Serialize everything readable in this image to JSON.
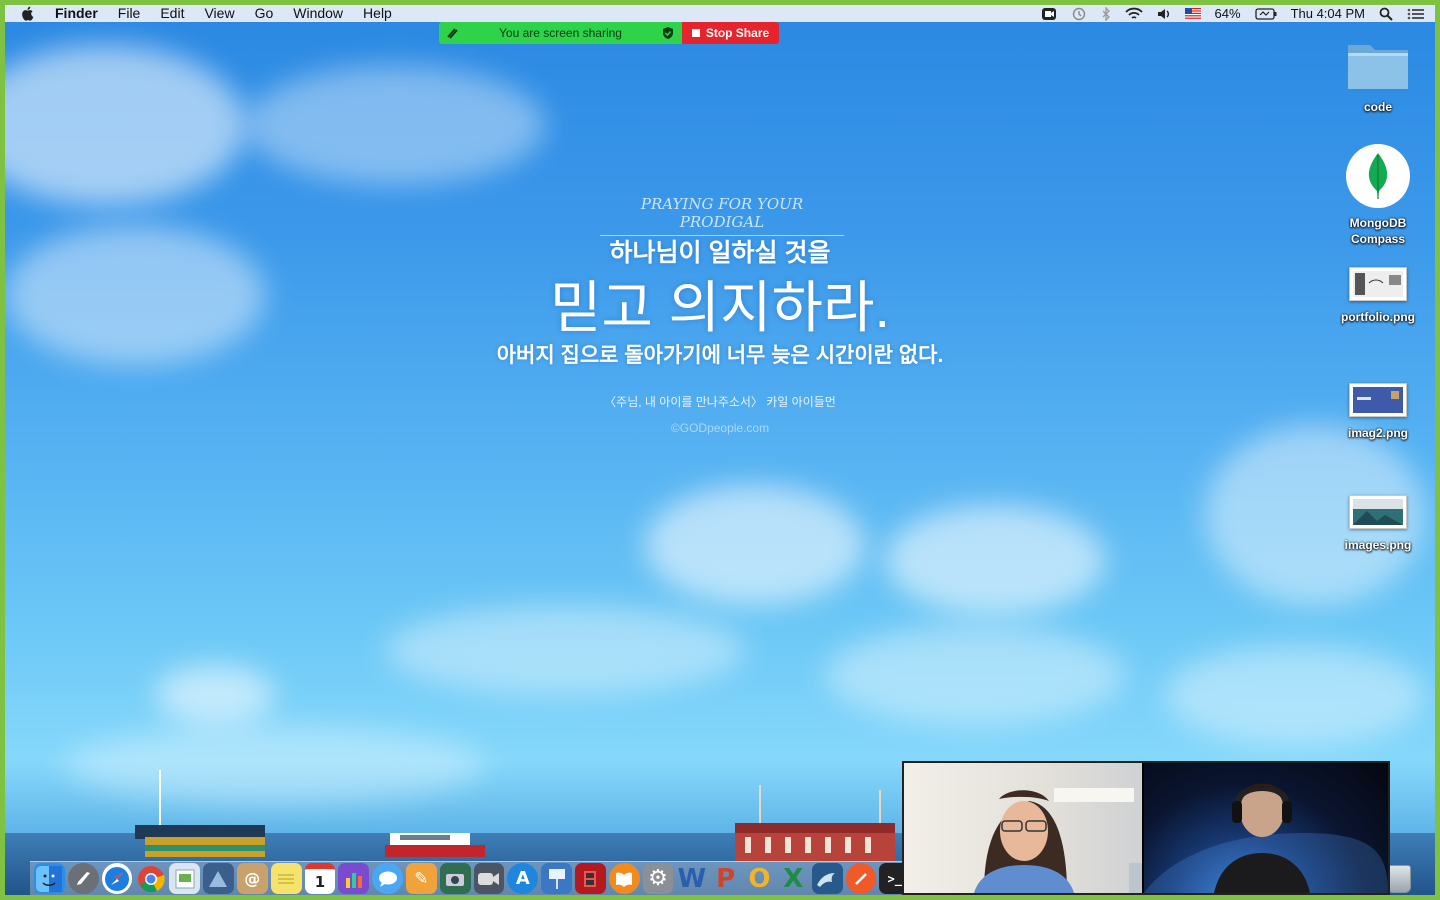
{
  "menubar": {
    "app_name": "Finder",
    "items": [
      "File",
      "Edit",
      "View",
      "Go",
      "Window",
      "Help"
    ],
    "status": {
      "battery": "64%",
      "clock": "Thu 4:04 PM"
    }
  },
  "screen_share": {
    "status_text": "You are screen sharing",
    "stop_label": "Stop Share"
  },
  "wallpaper": {
    "eyebrow": "PRAYING FOR YOUR PRODIGAL",
    "line1": "하나님이 일하실 것을",
    "line2": "믿고 의지하라.",
    "line3": "아버지 집으로 돌아가기에 너무 늦은 시간이란 없다.",
    "line4": "〈주님, 내 아이를 만나주소서〉 카일 아이들먼",
    "line5": "©GODpeople.com"
  },
  "desktop_icons": [
    {
      "label": "code",
      "icon": "folder-icon"
    },
    {
      "label": "MongoDB Compass",
      "icon": "mongodb-compass-icon"
    },
    {
      "label": "portfolio.png",
      "icon": "image-thumbnail-icon"
    },
    {
      "label": "imag2.png",
      "icon": "image-thumbnail-icon"
    },
    {
      "label": "images.png",
      "icon": "image-thumbnail-icon"
    }
  ],
  "dock": {
    "items": [
      {
        "name": "finder",
        "color": "#2b8fe8",
        "glyph": ""
      },
      {
        "name": "launchpad",
        "color": "#6b6f76",
        "glyph": "🚀"
      },
      {
        "name": "safari",
        "color": "#1e7ee0",
        "glyph": "⊕"
      },
      {
        "name": "chrome",
        "color": "#e8e8e8",
        "glyph": ""
      },
      {
        "name": "preview",
        "color": "#d9e6f2",
        "glyph": ""
      },
      {
        "name": "photo-app",
        "color": "#3a5f8c",
        "glyph": ""
      },
      {
        "name": "contacts",
        "color": "#c8a26a",
        "glyph": "@"
      },
      {
        "name": "notes",
        "color": "#f6e36b",
        "glyph": ""
      },
      {
        "name": "calendar",
        "color": "#ffffff",
        "glyph": "1"
      },
      {
        "name": "ibooks-author",
        "color": "#7a4bd1",
        "glyph": ""
      },
      {
        "name": "messages",
        "color": "#4aa7f3",
        "glyph": "💬"
      },
      {
        "name": "pages",
        "color": "#f0a33a",
        "glyph": "✎"
      },
      {
        "name": "image-capture",
        "color": "#2f6e4f",
        "glyph": ""
      },
      {
        "name": "facetime",
        "color": "#4b5563",
        "glyph": "◉"
      },
      {
        "name": "app-store",
        "color": "#1f86e0",
        "glyph": "A"
      },
      {
        "name": "keynote",
        "color": "#3a78c4",
        "glyph": ""
      },
      {
        "name": "photo-booth",
        "color": "#b3191f",
        "glyph": ""
      },
      {
        "name": "ibooks",
        "color": "#f38a1d",
        "glyph": "▣"
      },
      {
        "name": "system-preferences",
        "color": "#8b8f96",
        "glyph": "⚙"
      },
      {
        "name": "word",
        "color": "#2a5faf",
        "glyph": "W"
      },
      {
        "name": "powerpoint",
        "color": "#d0452a",
        "glyph": "P"
      },
      {
        "name": "outlook",
        "color": "#f0b42a",
        "glyph": "O"
      },
      {
        "name": "excel",
        "color": "#1e8c47",
        "glyph": "X"
      },
      {
        "name": "mysql-workbench",
        "color": "#275a8a",
        "glyph": ""
      },
      {
        "name": "postman",
        "color": "#f05a28",
        "glyph": ""
      },
      {
        "name": "terminal",
        "color": "#222222",
        "glyph": ">_"
      }
    ]
  }
}
